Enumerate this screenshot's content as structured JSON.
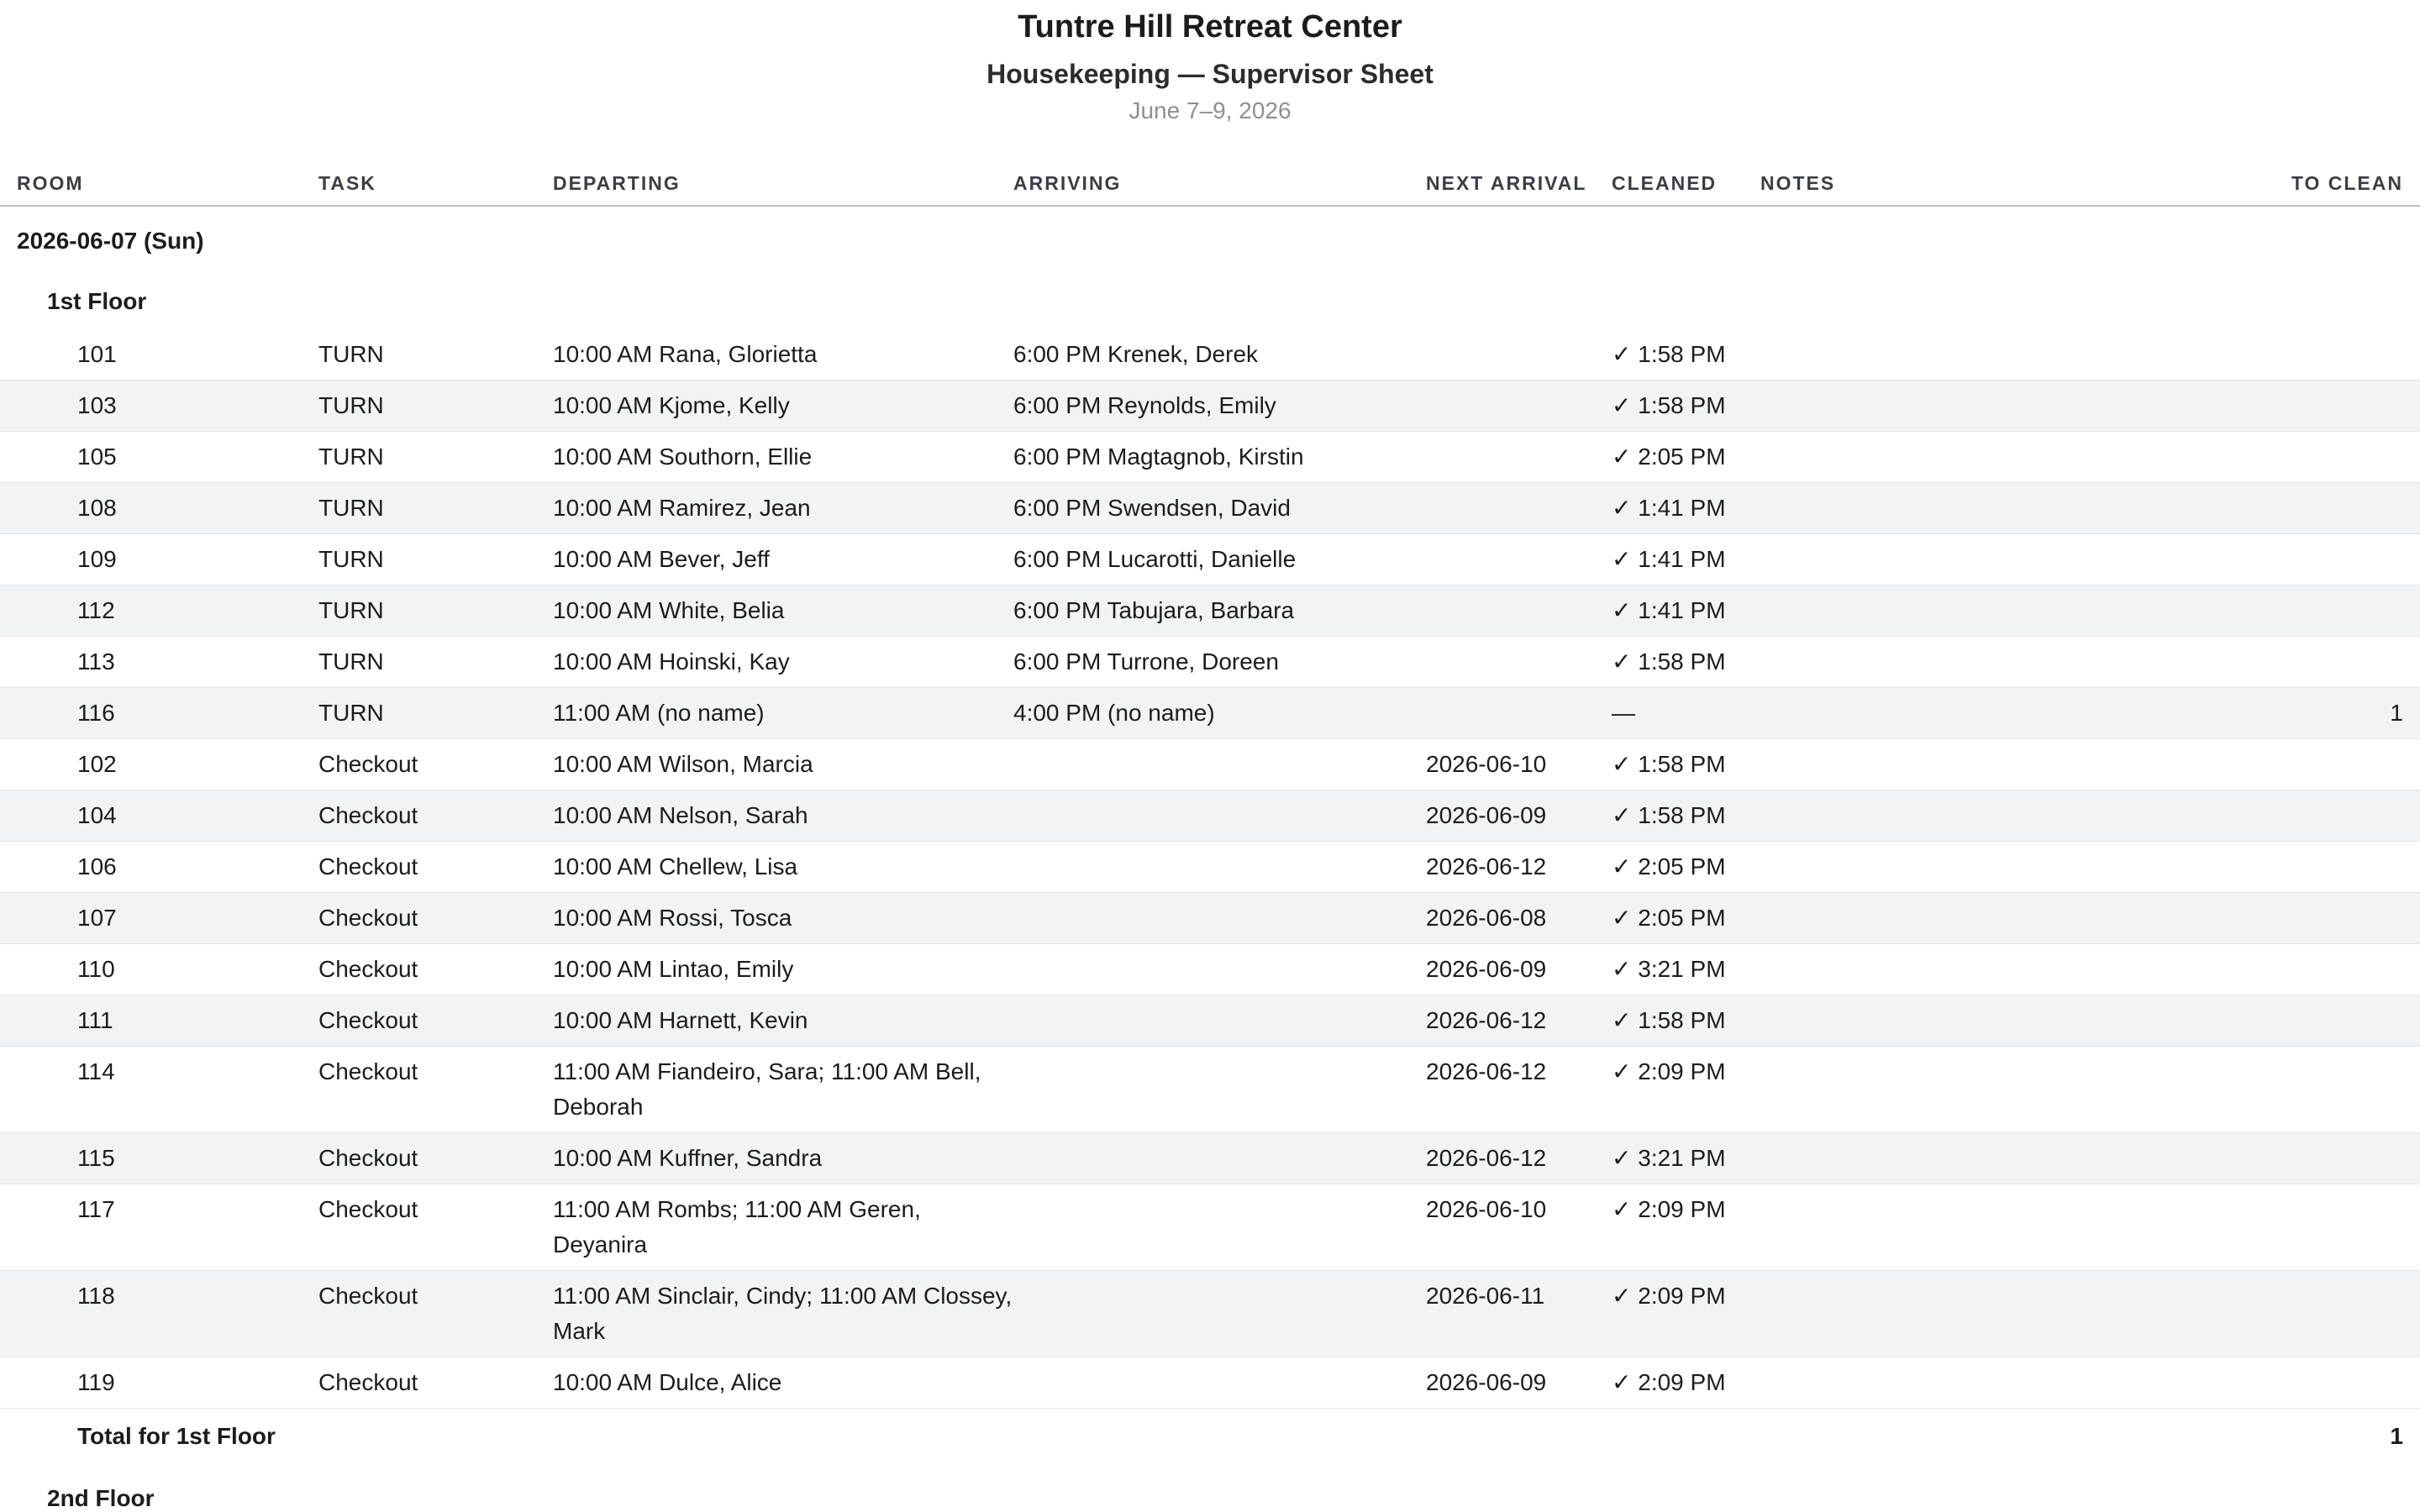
{
  "header": {
    "title": "Tuntre Hill Retreat Center",
    "subtitle": "Housekeeping — Supervisor Sheet",
    "date_range": "June 7–9, 2026"
  },
  "columns": [
    "ROOM",
    "TASK",
    "DEPARTING",
    "ARRIVING",
    "NEXT ARRIVAL",
    "CLEANED",
    "NOTES",
    "TO CLEAN"
  ],
  "day": "2026-06-07 (Sun)",
  "floor1": {
    "label": "1st Floor",
    "rows": [
      {
        "room": "101",
        "task": "TURN",
        "departing": "10:00 AM Rana, Glorietta",
        "arriving": "6:00 PM Krenek, Derek",
        "next": "",
        "cleaned": "✓ 1:58 PM",
        "notes": "",
        "to_clean": ""
      },
      {
        "room": "103",
        "task": "TURN",
        "departing": "10:00 AM Kjome, Kelly",
        "arriving": "6:00 PM Reynolds, Emily",
        "next": "",
        "cleaned": "✓ 1:58 PM",
        "notes": "",
        "to_clean": ""
      },
      {
        "room": "105",
        "task": "TURN",
        "departing": "10:00 AM Southorn, Ellie",
        "arriving": "6:00 PM Magtagnob, Kirstin",
        "next": "",
        "cleaned": "✓ 2:05 PM",
        "notes": "",
        "to_clean": ""
      },
      {
        "room": "108",
        "task": "TURN",
        "departing": "10:00 AM Ramirez, Jean",
        "arriving": "6:00 PM Swendsen, David",
        "next": "",
        "cleaned": "✓ 1:41 PM",
        "notes": "",
        "to_clean": ""
      },
      {
        "room": "109",
        "task": "TURN",
        "departing": "10:00 AM Bever, Jeff",
        "arriving": "6:00 PM Lucarotti, Danielle",
        "next": "",
        "cleaned": "✓ 1:41 PM",
        "notes": "",
        "to_clean": ""
      },
      {
        "room": "112",
        "task": "TURN",
        "departing": "10:00 AM White, Belia",
        "arriving": "6:00 PM Tabujara, Barbara",
        "next": "",
        "cleaned": "✓ 1:41 PM",
        "notes": "",
        "to_clean": ""
      },
      {
        "room": "113",
        "task": "TURN",
        "departing": "10:00 AM Hoinski, Kay",
        "arriving": "6:00 PM Turrone, Doreen",
        "next": "",
        "cleaned": "✓ 1:58 PM",
        "notes": "",
        "to_clean": ""
      },
      {
        "room": "116",
        "task": "TURN",
        "departing": "11:00 AM (no name)",
        "arriving": "4:00 PM (no name)",
        "next": "",
        "cleaned": "—",
        "notes": "",
        "to_clean": "1"
      },
      {
        "room": "102",
        "task": "Checkout",
        "departing": "10:00 AM Wilson, Marcia",
        "arriving": "",
        "next": "2026-06-10",
        "cleaned": "✓ 1:58 PM",
        "notes": "",
        "to_clean": ""
      },
      {
        "room": "104",
        "task": "Checkout",
        "departing": "10:00 AM Nelson, Sarah",
        "arriving": "",
        "next": "2026-06-09",
        "cleaned": "✓ 1:58 PM",
        "notes": "",
        "to_clean": ""
      },
      {
        "room": "106",
        "task": "Checkout",
        "departing": "10:00 AM Chellew, Lisa",
        "arriving": "",
        "next": "2026-06-12",
        "cleaned": "✓ 2:05 PM",
        "notes": "",
        "to_clean": ""
      },
      {
        "room": "107",
        "task": "Checkout",
        "departing": "10:00 AM Rossi, Tosca",
        "arriving": "",
        "next": "2026-06-08",
        "cleaned": "✓ 2:05 PM",
        "notes": "",
        "to_clean": ""
      },
      {
        "room": "110",
        "task": "Checkout",
        "departing": "10:00 AM Lintao, Emily",
        "arriving": "",
        "next": "2026-06-09",
        "cleaned": "✓ 3:21 PM",
        "notes": "",
        "to_clean": ""
      },
      {
        "room": "111",
        "task": "Checkout",
        "departing": "10:00 AM Harnett, Kevin",
        "arriving": "",
        "next": "2026-06-12",
        "cleaned": "✓ 1:58 PM",
        "notes": "",
        "to_clean": ""
      },
      {
        "room": "114",
        "task": "Checkout",
        "departing": "11:00 AM Fiandeiro, Sara; 11:00 AM Bell, Deborah",
        "arriving": "",
        "next": "2026-06-12",
        "cleaned": "✓ 2:09 PM",
        "notes": "",
        "to_clean": ""
      },
      {
        "room": "115",
        "task": "Checkout",
        "departing": "10:00 AM Kuffner, Sandra",
        "arriving": "",
        "next": "2026-06-12",
        "cleaned": "✓ 3:21 PM",
        "notes": "",
        "to_clean": ""
      },
      {
        "room": "117",
        "task": "Checkout",
        "departing": "11:00 AM Rombs; 11:00 AM Geren, Deyanira",
        "arriving": "",
        "next": "2026-06-10",
        "cleaned": "✓ 2:09 PM",
        "notes": "",
        "to_clean": ""
      },
      {
        "room": "118",
        "task": "Checkout",
        "departing": "11:00 AM Sinclair, Cindy; 11:00 AM Clossey, Mark",
        "arriving": "",
        "next": "2026-06-11",
        "cleaned": "✓ 2:09 PM",
        "notes": "",
        "to_clean": ""
      },
      {
        "room": "119",
        "task": "Checkout",
        "departing": "10:00 AM Dulce, Alice",
        "arriving": "",
        "next": "2026-06-09",
        "cleaned": "✓ 2:09 PM",
        "notes": "",
        "to_clean": ""
      }
    ],
    "total_label": "Total for 1st Floor",
    "total_value": "1"
  },
  "floor2": {
    "label": "2nd Floor"
  }
}
